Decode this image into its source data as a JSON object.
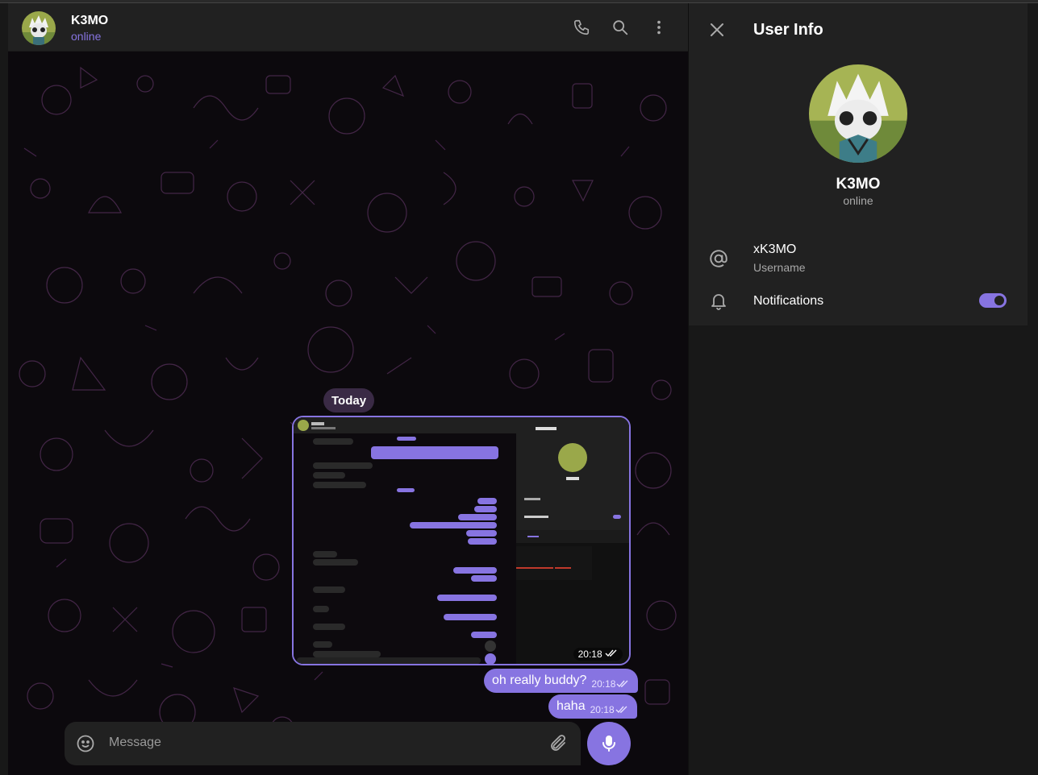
{
  "chat": {
    "title": "K3MO",
    "status": "online",
    "date_separator": "Today",
    "messages": [
      {
        "type": "photo",
        "time": "20:18"
      },
      {
        "type": "text",
        "text": "oh really buddy?",
        "time": "20:18"
      },
      {
        "type": "text",
        "text": "haha",
        "time": "20:18"
      }
    ],
    "composer_placeholder": "Message"
  },
  "panel": {
    "title": "User Info",
    "name": "K3MO",
    "status": "online",
    "username_value": "xK3MO",
    "username_label": "Username",
    "notifications_label": "Notifications",
    "notifications_on": true
  },
  "colors": {
    "accent": "#8774e1",
    "panel_bg": "#212121",
    "wall_bg": "#0c090d"
  },
  "icons": [
    "phone-icon",
    "search-icon",
    "more-vertical-icon",
    "close-icon",
    "at-icon",
    "bell-icon",
    "emoji-icon",
    "attach-icon",
    "mic-icon",
    "double-check-icon"
  ]
}
